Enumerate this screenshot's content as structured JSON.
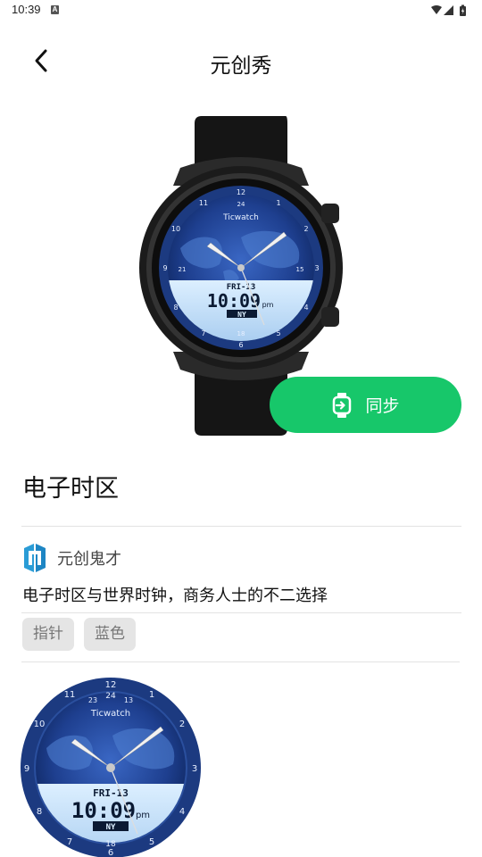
{
  "status_bar": {
    "time": "10:39",
    "notification_badge": "A",
    "icons": [
      "wifi-icon",
      "cellular-signal-icon",
      "battery-icon"
    ]
  },
  "app_bar": {
    "back_icon": "chevron-left-icon",
    "title": "元创秀"
  },
  "hero": {
    "watch_face": {
      "brand": "Ticwatch",
      "date": "FRI-13",
      "time": "10:09",
      "ampm": "pm",
      "zone": "NY",
      "dial_numbers": [
        "12",
        "1",
        "2",
        "3",
        "4",
        "5",
        "6",
        "7",
        "8",
        "9",
        "10",
        "11"
      ],
      "ring_numbers": [
        "24",
        "13",
        "14",
        "15",
        "16",
        "17",
        "18",
        "19",
        "20",
        "21",
        "22",
        "23"
      ]
    }
  },
  "sync_button": {
    "icon": "watch-sync-icon",
    "label": "同步",
    "color": "#17c76a"
  },
  "detail": {
    "face_name": "电子时区",
    "author": {
      "logo_icon": "brand-logo-icon",
      "name": "元创鬼才"
    },
    "description": "电子时区与世界时钟，商务人士的不二选择",
    "tags": [
      "指针",
      "蓝色"
    ]
  },
  "colors": {
    "accent": "#17c76a",
    "dial_blue": "#1e3f8f",
    "tag_bg": "#e5e5e5"
  }
}
